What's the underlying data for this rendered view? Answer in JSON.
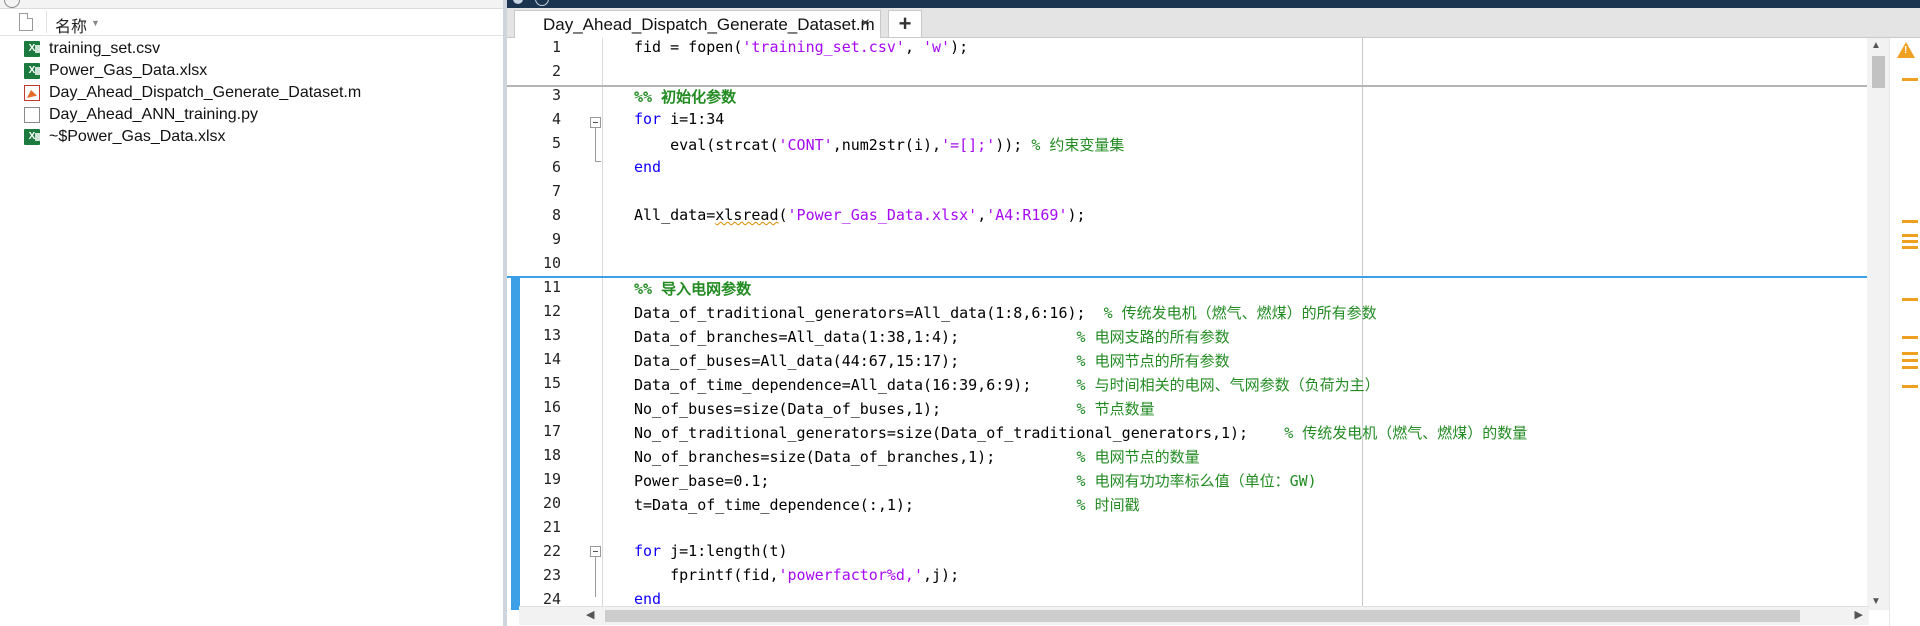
{
  "file_browser": {
    "column_header": "名称",
    "files": [
      {
        "name": "training_set.csv",
        "icon": "excel-icon"
      },
      {
        "name": "Power_Gas_Data.xlsx",
        "icon": "excel-icon"
      },
      {
        "name": "Day_Ahead_Dispatch_Generate_Dataset.m",
        "icon": "matlab-file-icon"
      },
      {
        "name": "Day_Ahead_ANN_training.py",
        "icon": "python-file-icon"
      },
      {
        "name": "~$Power_Gas_Data.xlsx",
        "icon": "excel-icon"
      }
    ]
  },
  "editor": {
    "active_tab": "Day_Ahead_Dispatch_Generate_Dataset.m",
    "add_tab_label": "+",
    "tab_close_label": "×",
    "colors": {
      "keyword": "#0e00ff",
      "string": "#a709f5",
      "comment": "#228b22",
      "section_bar": "#3ba0e6",
      "warning": "#f0a020"
    },
    "lines": [
      {
        "n": "1",
        "tokens": [
          {
            "t": "fid = fopen(",
            "c": ""
          },
          {
            "t": "'training_set.csv'",
            "c": "str"
          },
          {
            "t": ", ",
            "c": ""
          },
          {
            "t": "'w'",
            "c": "str"
          },
          {
            "t": ");",
            "c": ""
          }
        ]
      },
      {
        "n": "2",
        "tokens": []
      },
      {
        "n": "3",
        "tokens": [
          {
            "t": "%% 初始化参数",
            "c": "cmb"
          }
        ]
      },
      {
        "n": "4",
        "tokens": [
          {
            "t": "for",
            "c": "kw"
          },
          {
            "t": " i=1:34",
            "c": ""
          }
        ]
      },
      {
        "n": "5",
        "tokens": [
          {
            "t": "    eval(strcat(",
            "c": ""
          },
          {
            "t": "'CONT'",
            "c": "str"
          },
          {
            "t": ",num2str(i),",
            "c": ""
          },
          {
            "t": "'=[];'",
            "c": "str"
          },
          {
            "t": ")); ",
            "c": ""
          },
          {
            "t": "% 约束变量集",
            "c": "cm"
          }
        ]
      },
      {
        "n": "6",
        "tokens": [
          {
            "t": "end",
            "c": "kw"
          }
        ]
      },
      {
        "n": "7",
        "tokens": []
      },
      {
        "n": "8",
        "tokens": [
          {
            "t": "All_data=",
            "c": ""
          },
          {
            "t": "xlsread",
            "c": "sq"
          },
          {
            "t": "(",
            "c": ""
          },
          {
            "t": "'Power_Gas_Data.xlsx'",
            "c": "str"
          },
          {
            "t": ",",
            "c": ""
          },
          {
            "t": "'A4:R169'",
            "c": "str"
          },
          {
            "t": ");",
            "c": ""
          }
        ]
      },
      {
        "n": "9",
        "tokens": []
      },
      {
        "n": "10",
        "tokens": []
      },
      {
        "n": "11",
        "tokens": [
          {
            "t": "%% 导入电网参数",
            "c": "cmb"
          }
        ]
      },
      {
        "n": "12",
        "tokens": [
          {
            "t": "Data_of_traditional_generators=All_data(1:8,6:16);  ",
            "c": ""
          },
          {
            "t": "% 传统发电机（燃气、燃煤）的所有参数",
            "c": "cm"
          }
        ]
      },
      {
        "n": "13",
        "tokens": [
          {
            "t": "Data_of_branches=All_data(1:38,1:4);             ",
            "c": ""
          },
          {
            "t": "% 电网支路的所有参数",
            "c": "cm"
          }
        ]
      },
      {
        "n": "14",
        "tokens": [
          {
            "t": "Data_of_buses=All_data(44:67,15:17);             ",
            "c": ""
          },
          {
            "t": "% 电网节点的所有参数",
            "c": "cm"
          }
        ]
      },
      {
        "n": "15",
        "tokens": [
          {
            "t": "Data_of_time_dependence=All_data(16:39,6:9);     ",
            "c": ""
          },
          {
            "t": "% 与时间相关的电网、气网参数（负荷为主）",
            "c": "cm"
          }
        ]
      },
      {
        "n": "16",
        "tokens": [
          {
            "t": "No_of_buses=size(Data_of_buses,1);               ",
            "c": ""
          },
          {
            "t": "% 节点数量",
            "c": "cm"
          }
        ]
      },
      {
        "n": "17",
        "tokens": [
          {
            "t": "No_of_traditional_generators=size(Data_of_traditional_generators,1);    ",
            "c": ""
          },
          {
            "t": "% 传统发电机（燃气、燃煤）的数量",
            "c": "cm"
          }
        ]
      },
      {
        "n": "18",
        "tokens": [
          {
            "t": "No_of_branches=size(Data_of_branches,1);         ",
            "c": ""
          },
          {
            "t": "% 电网节点的数量",
            "c": "cm"
          }
        ]
      },
      {
        "n": "19",
        "tokens": [
          {
            "t": "Power_base=0.1;                                  ",
            "c": ""
          },
          {
            "t": "% 电网有功功率标么值（单位：GW)",
            "c": "cm"
          }
        ]
      },
      {
        "n": "20",
        "tokens": [
          {
            "t": "t=Data_of_time_dependence(:,1);                  ",
            "c": ""
          },
          {
            "t": "% 时间戳",
            "c": "cm"
          }
        ]
      },
      {
        "n": "21",
        "tokens": []
      },
      {
        "n": "22",
        "tokens": [
          {
            "t": "for",
            "c": "kw"
          },
          {
            "t": " j=1:length(t)",
            "c": ""
          }
        ]
      },
      {
        "n": "23",
        "tokens": [
          {
            "t": "    fprintf(fid,",
            "c": ""
          },
          {
            "t": "'powerfactor%d,'",
            "c": "str"
          },
          {
            "t": ",j);",
            "c": ""
          }
        ]
      },
      {
        "n": "24",
        "tokens": [
          {
            "t": "end",
            "c": "kw"
          }
        ]
      }
    ]
  }
}
